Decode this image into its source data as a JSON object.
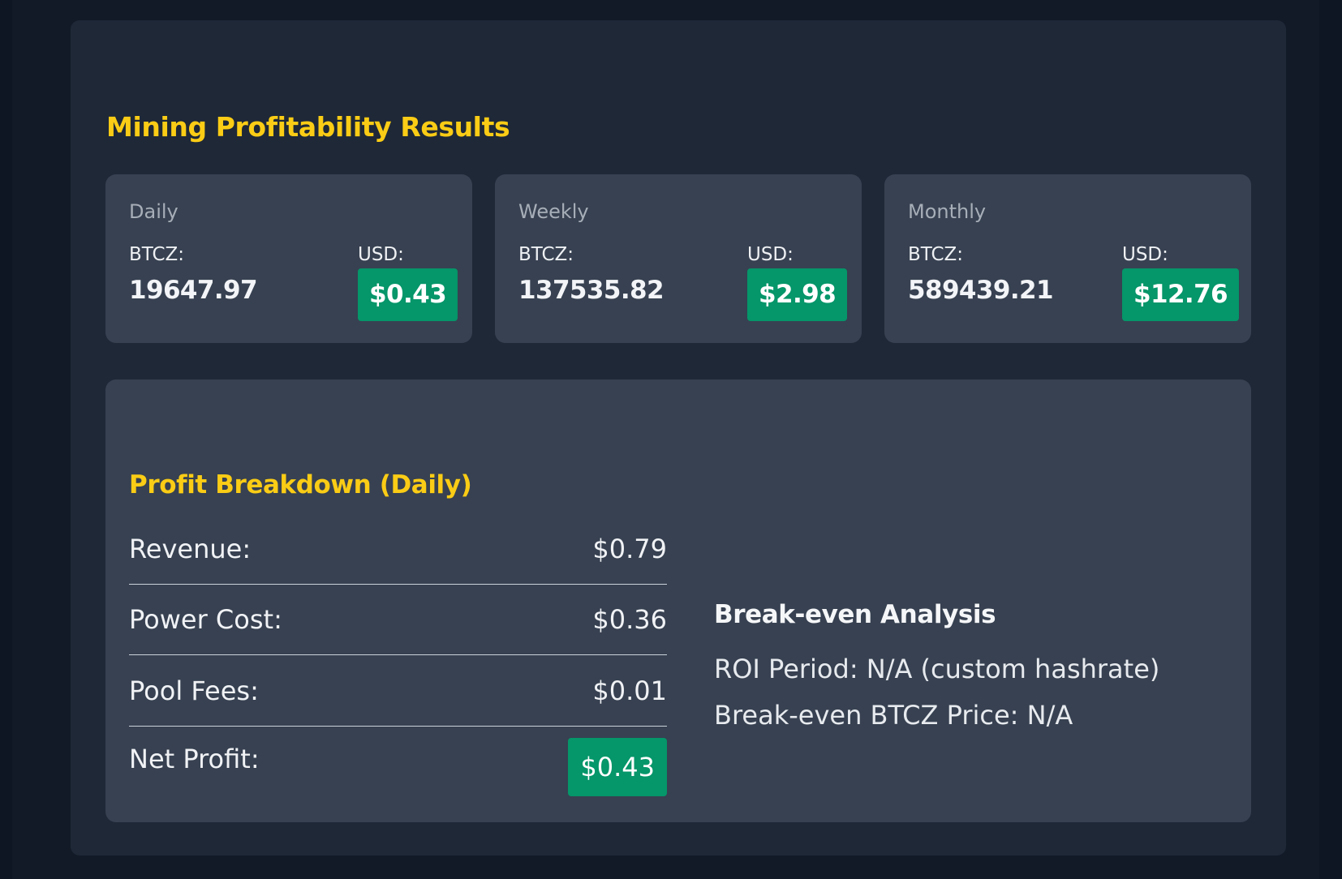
{
  "results": {
    "title": "Mining Profitability Results",
    "periods": [
      {
        "label": "Daily",
        "btcz_label": "BTCZ:",
        "btcz_value": "19647.97",
        "usd_label": "USD:",
        "usd_value": "$0.43"
      },
      {
        "label": "Weekly",
        "btcz_label": "BTCZ:",
        "btcz_value": "137535.82",
        "usd_label": "USD:",
        "usd_value": "$2.98"
      },
      {
        "label": "Monthly",
        "btcz_label": "BTCZ:",
        "btcz_value": "589439.21",
        "usd_label": "USD:",
        "usd_value": "$12.76"
      }
    ]
  },
  "breakdown": {
    "title": "Profit Breakdown (Daily)",
    "rows": [
      {
        "label": "Revenue:",
        "value": "$0.79"
      },
      {
        "label": "Power Cost:",
        "value": "$0.36"
      },
      {
        "label": "Pool Fees:",
        "value": "$0.01"
      },
      {
        "label": "Net Profit:",
        "value": "$0.43"
      }
    ]
  },
  "breakeven": {
    "title": "Break-even Analysis",
    "roi_period": "ROI Period: N/A (custom hashrate)",
    "price": "Break-even BTCZ Price: N/A"
  },
  "colors": {
    "background": "#0f1623",
    "panel": "#1e2837",
    "card": "#374151",
    "accent_yellow": "#facc15",
    "success_green": "#059669"
  }
}
